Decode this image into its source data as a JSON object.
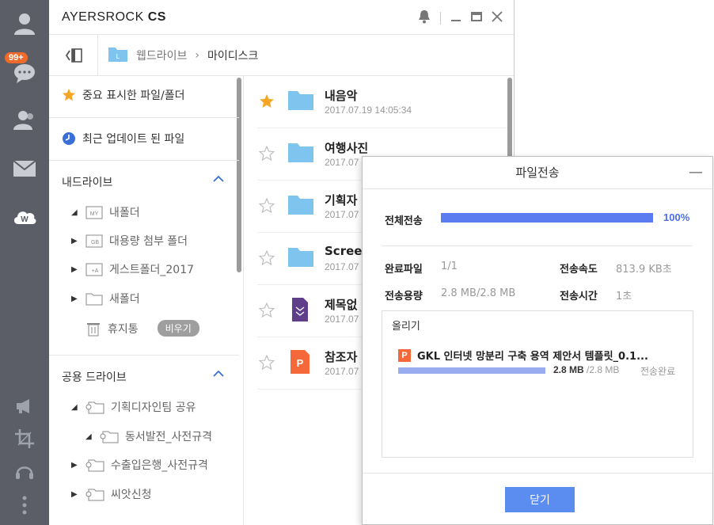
{
  "rail": {
    "badge": "99+",
    "icons": [
      "user-icon",
      "chat-icon",
      "contacts-icon",
      "mail-icon",
      "cloud-drive-icon",
      "megaphone-icon",
      "crop-icon",
      "headset-icon",
      "more-icon"
    ],
    "color": "#5b5e66"
  },
  "window": {
    "title_regular": "AYERSROCK ",
    "title_bold": "CS"
  },
  "breadcrumb": {
    "root": "웹드라이브",
    "separator": "›",
    "current": "마이디스크"
  },
  "tree": {
    "favorites": "중요 표시한 파일/폴더",
    "recent": "최근 업데이트 된 파일",
    "my_drive": {
      "label": "내드라이브",
      "items": [
        {
          "label": "내폴더",
          "icon_text": "MY"
        },
        {
          "label": "대용량 첨부 폴더",
          "icon_text": "GB"
        },
        {
          "label": "게스트폴더_2017",
          "icon_text": "+A"
        },
        {
          "label": "새폴더",
          "icon_text": ""
        },
        {
          "label": "휴지통",
          "icon_text": ""
        }
      ],
      "empty_trash": "비우기"
    },
    "shared_drive": {
      "label": "공용 드라이브",
      "items": [
        {
          "label": "기획디자인팀 공유"
        },
        {
          "label": "동서발전_사전규격"
        },
        {
          "label": "수출입은행_사전규격"
        },
        {
          "label": "씨앗신청"
        }
      ]
    }
  },
  "files": [
    {
      "name": "내음악",
      "date": "2017.07.19 14:05:34",
      "starred": true,
      "type": "folder"
    },
    {
      "name": "여행사진",
      "date": "2017.07",
      "starred": false,
      "type": "folder"
    },
    {
      "name": "기획자",
      "date": "2017.07",
      "starred": false,
      "type": "folder"
    },
    {
      "name": "Screen",
      "date": "2017.07",
      "starred": false,
      "type": "folder"
    },
    {
      "name": "제목없",
      "date": "2017.07",
      "starred": false,
      "type": "doc"
    },
    {
      "name": "참조자",
      "date": "2017.07",
      "starred": false,
      "type": "ppt"
    }
  ],
  "dialog": {
    "title": "파일전송",
    "minimize": "—",
    "total_label": "전체전송",
    "total_progress": 1.0,
    "total_percent": "100%",
    "done_files_label": "완료파일",
    "done_files_value": "1/1",
    "speed_label": "전송속도",
    "speed_value": "813.9 KB초",
    "size_label": "전송용량",
    "size_value": "2.8 MB/2.8 MB",
    "time_label": "전송시간",
    "time_value": "1초",
    "upload_title": "올리기",
    "upload_file": "GKL 인터넷 망분리 구축 용역 제안서 템플릿_0.1...",
    "upload_file_icon_text": "P",
    "upload_size_done": "2.8 MB",
    "upload_size_total": " /2.8 MB",
    "upload_status": "전송완료",
    "close_label": "닫기",
    "accent": "#5b7cf0"
  }
}
